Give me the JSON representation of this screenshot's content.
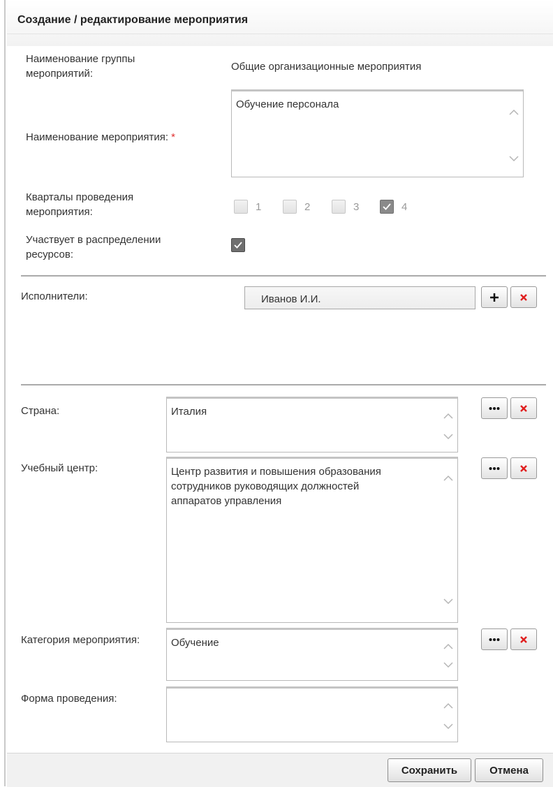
{
  "dialog": {
    "title": "Создание / редактирование мероприятия"
  },
  "group": {
    "label": "Наименование группы\nмероприятий:",
    "value": "Общие организационные мероприятия"
  },
  "event_name": {
    "label": "Наименование мероприятия:",
    "required_mark": "*",
    "value": "Обучение персонала"
  },
  "quarters": {
    "label": "Кварталы проведения\nмероприятия:",
    "items": [
      {
        "number": "1",
        "checked": false
      },
      {
        "number": "2",
        "checked": false
      },
      {
        "number": "3",
        "checked": false
      },
      {
        "number": "4",
        "checked": true
      }
    ]
  },
  "resources": {
    "label": "Участвует в распределении\nресурсов:",
    "checked": true
  },
  "executors": {
    "label": "Исполнители:",
    "value": "Иванов И.И."
  },
  "country": {
    "label": "Страна:",
    "value": "Италия"
  },
  "training_center": {
    "label": "Учебный центр:",
    "value": "Центр развития и повышения образования\nсотрудников руководящих должностей\nаппаратов управления"
  },
  "category": {
    "label": "Категория мероприятия:",
    "value": "Обучение"
  },
  "form": {
    "label": "Форма проведения:",
    "value": ""
  },
  "footer": {
    "save_label": "Сохранить",
    "cancel_label": "Отмена"
  },
  "colors": {
    "remove_icon": "#e02020",
    "required": "#e03030",
    "checked_box": "#8a8a8a"
  }
}
